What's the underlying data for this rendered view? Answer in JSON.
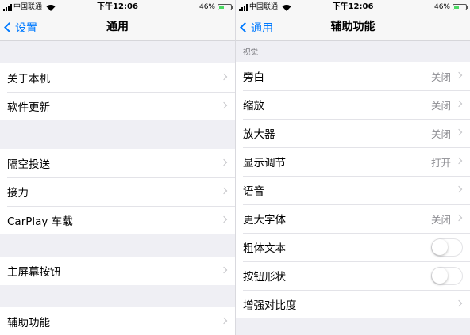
{
  "status_bar": {
    "carrier": "中国联通",
    "time": "下午12:06",
    "battery": "46%",
    "battery_level": 0.46
  },
  "left": {
    "back_label": "设置",
    "title": "通用",
    "groups": [
      [
        {
          "label": "关于本机"
        },
        {
          "label": "软件更新"
        }
      ],
      [
        {
          "label": "隔空投送"
        },
        {
          "label": "接力"
        },
        {
          "label": "CarPlay 车载"
        }
      ],
      [
        {
          "label": "主屏幕按钮"
        }
      ],
      [
        {
          "label": "辅助功能"
        }
      ]
    ]
  },
  "right": {
    "back_label": "通用",
    "title": "辅助功能",
    "section_header": "视觉",
    "rows": [
      {
        "label": "旁白",
        "value": "关闭"
      },
      {
        "label": "缩放",
        "value": "关闭"
      },
      {
        "label": "放大器",
        "value": "关闭"
      },
      {
        "label": "显示调节",
        "value": "打开"
      },
      {
        "label": "语音",
        "value": ""
      },
      {
        "label": "更大字体",
        "value": "关闭"
      },
      {
        "label": "粗体文本",
        "toggle": false
      },
      {
        "label": "按钮形状",
        "toggle": false
      },
      {
        "label": "增强对比度",
        "value": ""
      }
    ]
  },
  "colors": {
    "accent": "#007aff",
    "battery_fill": "#4cd964",
    "grouped_background": "#efeff4",
    "secondary_text": "#8e8e93"
  },
  "icons": [
    "signal-icon",
    "wifi-icon",
    "battery-icon",
    "back-chevron-icon",
    "chevron-right-icon"
  ]
}
